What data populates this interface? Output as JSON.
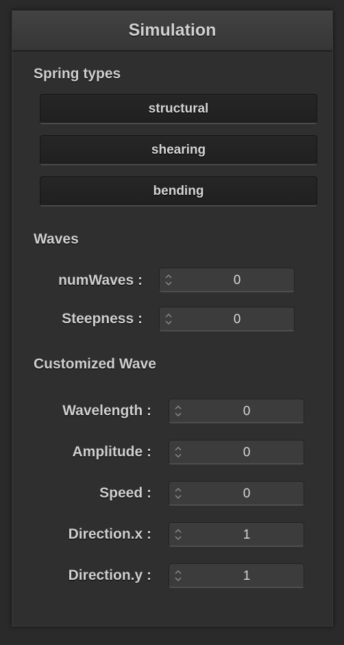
{
  "panel": {
    "title": "Simulation"
  },
  "spring_types": {
    "title": "Spring types",
    "buttons": [
      "structural",
      "shearing",
      "bending"
    ]
  },
  "waves": {
    "title": "Waves",
    "fields": [
      {
        "label": "numWaves :",
        "value": "0"
      },
      {
        "label": "Steepness :",
        "value": "0"
      }
    ]
  },
  "customized_wave": {
    "title": "Customized Wave",
    "fields": [
      {
        "label": "Wavelength :",
        "value": "0"
      },
      {
        "label": "Amplitude :",
        "value": "0"
      },
      {
        "label": "Speed :",
        "value": "0"
      },
      {
        "label": "Direction.x :",
        "value": "1"
      },
      {
        "label": "Direction.y :",
        "value": "1"
      }
    ]
  },
  "icons": {
    "spin": "spinbox-arrows-icon"
  }
}
